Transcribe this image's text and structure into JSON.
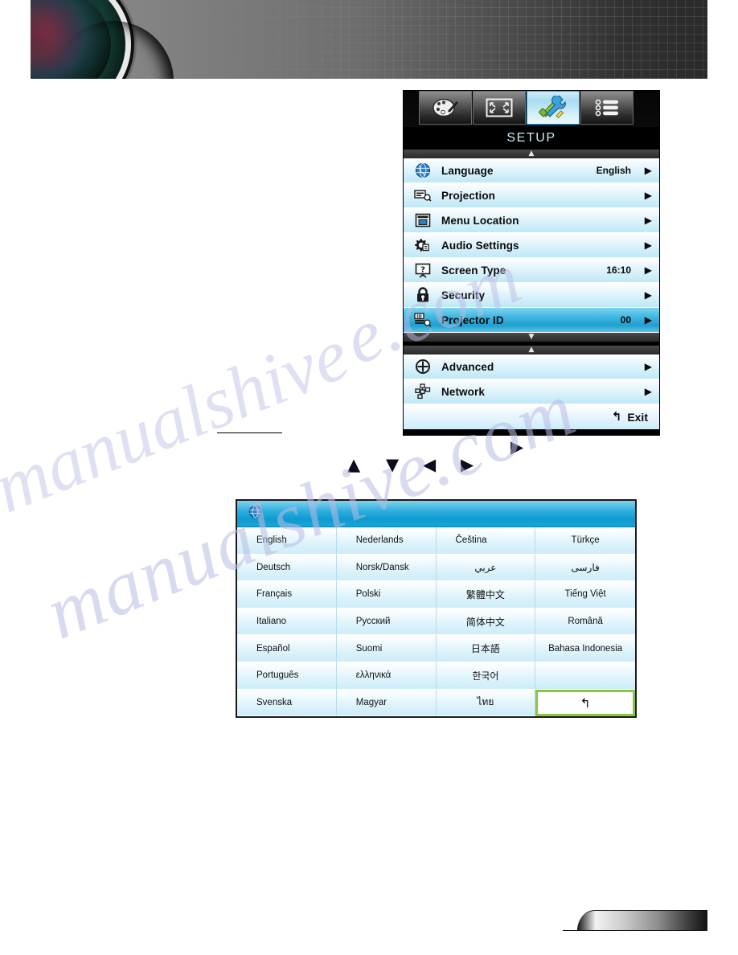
{
  "page": {
    "watermark": "manualshive.com",
    "watermark_fragment_right": "e.com",
    "watermark_fragment_left": "manualshive"
  },
  "osd": {
    "title": "SETUP",
    "tabs": [
      {
        "name": "image-tab",
        "icon": "palette-icon",
        "active": false
      },
      {
        "name": "display-tab",
        "icon": "screen-resize-icon",
        "active": false
      },
      {
        "name": "setup-tab",
        "icon": "tools-icon",
        "active": true
      },
      {
        "name": "options-tab",
        "icon": "list-icon",
        "active": false
      }
    ],
    "scroll_up_glyph": "▲",
    "scroll_down_glyph": "▼",
    "items": [
      {
        "icon": "globe-icon",
        "label": "Language",
        "value": "English",
        "arrow": "▶",
        "highlight": false
      },
      {
        "icon": "projection-icon",
        "label": "Projection",
        "value": "",
        "arrow": "▶",
        "highlight": false
      },
      {
        "icon": "menu-location-icon",
        "label": "Menu Location",
        "value": "",
        "arrow": "▶",
        "highlight": false
      },
      {
        "icon": "audio-settings-icon",
        "label": "Audio Settings",
        "value": "",
        "arrow": "▶",
        "highlight": false
      },
      {
        "icon": "screen-type-icon",
        "label": "Screen Type",
        "value": "16:10",
        "arrow": "▶",
        "highlight": false
      },
      {
        "icon": "lock-icon",
        "label": "Security",
        "value": "",
        "arrow": "▶",
        "highlight": false
      },
      {
        "icon": "projector-id-icon",
        "label": "Projector ID",
        "value": "00",
        "arrow": "▶",
        "highlight": true
      }
    ],
    "items_below": [
      {
        "icon": "advanced-icon",
        "label": "Advanced",
        "value": "",
        "arrow": "▶",
        "highlight": false
      },
      {
        "icon": "network-icon",
        "label": "Network",
        "value": "",
        "arrow": "▶",
        "highlight": false
      }
    ],
    "exit": {
      "label": "Exit",
      "icon": "back-arrow-icon",
      "glyph": "↰"
    }
  },
  "nav_glyphs": {
    "right_raised": "▶",
    "up": "▲",
    "down": "▼",
    "left": "◀",
    "right": "▶"
  },
  "language_dialog": {
    "header_icon": "globe-icon",
    "columns": 4,
    "rows": [
      [
        "English",
        "Nederlands",
        "Čeština",
        "Türkçe"
      ],
      [
        "Deutsch",
        "Norsk/Dansk",
        "عربي",
        "فارسی"
      ],
      [
        "Français",
        "Polski",
        "繁體中文",
        "Tiếng Việt"
      ],
      [
        "Italiano",
        "Русский",
        "简体中文",
        "Română"
      ],
      [
        "Español",
        "Suomi",
        "日本語",
        "Bahasa Indonesia"
      ],
      [
        "Português",
        "ελληνικά",
        "한국어",
        ""
      ],
      [
        "Svenska",
        "Magyar",
        "ไทย",
        "↰"
      ]
    ],
    "back_button": {
      "name": "back-button",
      "glyph": "↰",
      "border_color": "#8cc63e"
    }
  },
  "colors": {
    "osd_highlight": "#1f9fd0",
    "osd_panel": "#cdedf9",
    "osd_title_text": "#cfe9f8",
    "lang_header": "#0f9ad0",
    "back_button_border": "#8cc63e",
    "watermark": "#b9bde4"
  }
}
